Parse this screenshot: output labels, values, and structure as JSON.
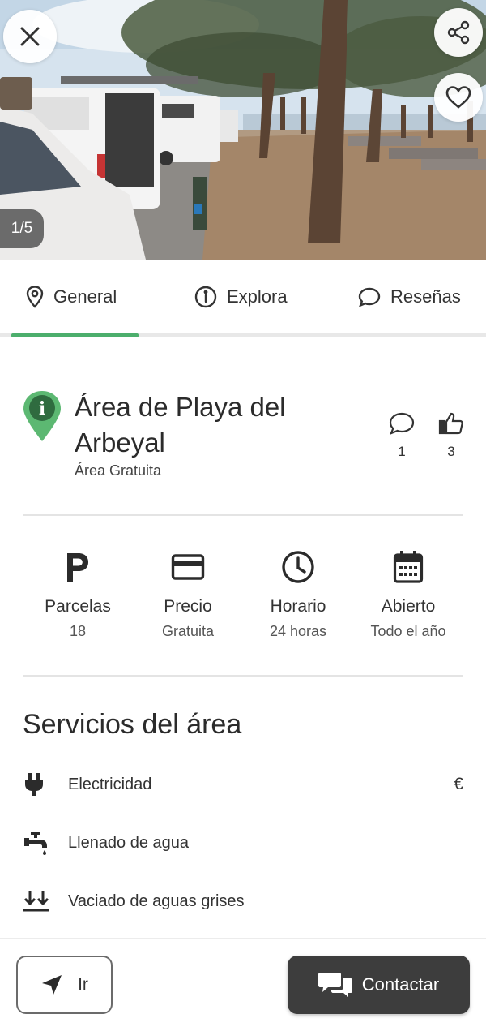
{
  "gallery": {
    "counter": "1/5",
    "close_icon": "close-icon",
    "share_icon": "share-icon",
    "favorite_icon": "heart-icon"
  },
  "tabs": [
    {
      "label": "General",
      "icon": "map-pin-icon",
      "active": true
    },
    {
      "label": "Explora",
      "icon": "info-icon",
      "active": false
    },
    {
      "label": "Reseñas",
      "icon": "comment-icon",
      "active": false
    }
  ],
  "place": {
    "title": "Área de Playa del Arbeyal",
    "type": "Área Gratuita",
    "comments_count": "1",
    "likes_count": "3"
  },
  "info": [
    {
      "label": "Parcelas",
      "value": "18",
      "icon": "parking-icon"
    },
    {
      "label": "Precio",
      "value": "Gratuita",
      "icon": "card-icon"
    },
    {
      "label": "Horario",
      "value": "24 horas",
      "icon": "clock-icon"
    },
    {
      "label": "Abierto",
      "value": "Todo el año",
      "icon": "calendar-icon"
    }
  ],
  "services": {
    "title": "Servicios del área",
    "items": [
      {
        "label": "Electricidad",
        "price": "€",
        "icon": "plug-icon"
      },
      {
        "label": "Llenado de agua",
        "price": "",
        "icon": "faucet-icon"
      },
      {
        "label": "Vaciado de aguas grises",
        "price": "",
        "icon": "drain-icon"
      }
    ]
  },
  "actions": {
    "go_label": "Ir",
    "contact_label": "Contactar"
  },
  "colors": {
    "accent": "#4cae6c",
    "pin": "#5cb872",
    "dark_button": "#3d3d3d"
  }
}
